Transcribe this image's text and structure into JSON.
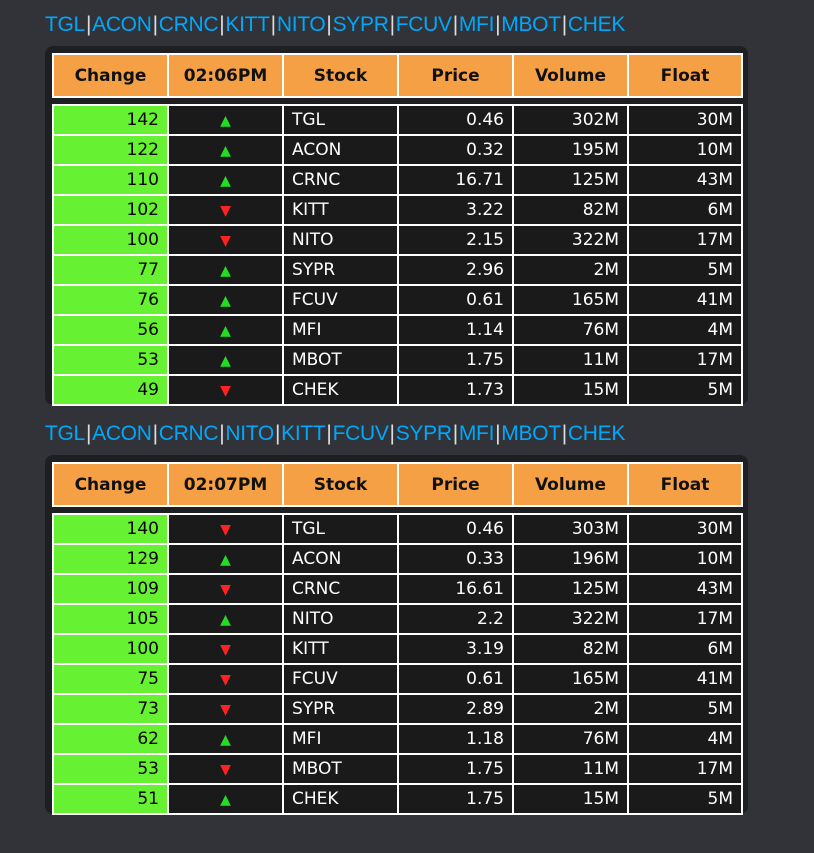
{
  "colors": {
    "header_bg": "#f5a045",
    "change_bg": "#66f233",
    "up": "#22dd22",
    "down": "#ff2222",
    "link": "#00a8fc"
  },
  "snapshots": [
    {
      "tickers": [
        "TGL",
        "ACON",
        "CRNC",
        "KITT",
        "NITO",
        "SYPR",
        "FCUV",
        "MFI",
        "MBOT",
        "CHEK"
      ],
      "headers": {
        "change": "Change",
        "time": "02:06PM",
        "stock": "Stock",
        "price": "Price",
        "volume": "Volume",
        "float": "Float"
      },
      "rows": [
        {
          "change": "142",
          "dir": "up",
          "stock": "TGL",
          "price": "0.46",
          "volume": "302M",
          "float": "30M"
        },
        {
          "change": "122",
          "dir": "up",
          "stock": "ACON",
          "price": "0.32",
          "volume": "195M",
          "float": "10M"
        },
        {
          "change": "110",
          "dir": "up",
          "stock": "CRNC",
          "price": "16.71",
          "volume": "125M",
          "float": "43M"
        },
        {
          "change": "102",
          "dir": "down",
          "stock": "KITT",
          "price": "3.22",
          "volume": "82M",
          "float": "6M"
        },
        {
          "change": "100",
          "dir": "down",
          "stock": "NITO",
          "price": "2.15",
          "volume": "322M",
          "float": "17M"
        },
        {
          "change": "77",
          "dir": "up",
          "stock": "SYPR",
          "price": "2.96",
          "volume": "2M",
          "float": "5M"
        },
        {
          "change": "76",
          "dir": "up",
          "stock": "FCUV",
          "price": "0.61",
          "volume": "165M",
          "float": "41M"
        },
        {
          "change": "56",
          "dir": "up",
          "stock": "MFI",
          "price": "1.14",
          "volume": "76M",
          "float": "4M"
        },
        {
          "change": "53",
          "dir": "up",
          "stock": "MBOT",
          "price": "1.75",
          "volume": "11M",
          "float": "17M"
        },
        {
          "change": "49",
          "dir": "down",
          "stock": "CHEK",
          "price": "1.73",
          "volume": "15M",
          "float": "5M"
        }
      ]
    },
    {
      "tickers": [
        "TGL",
        "ACON",
        "CRNC",
        "NITO",
        "KITT",
        "FCUV",
        "SYPR",
        "MFI",
        "MBOT",
        "CHEK"
      ],
      "headers": {
        "change": "Change",
        "time": "02:07PM",
        "stock": "Stock",
        "price": "Price",
        "volume": "Volume",
        "float": "Float"
      },
      "rows": [
        {
          "change": "140",
          "dir": "down",
          "stock": "TGL",
          "price": "0.46",
          "volume": "303M",
          "float": "30M"
        },
        {
          "change": "129",
          "dir": "up",
          "stock": "ACON",
          "price": "0.33",
          "volume": "196M",
          "float": "10M"
        },
        {
          "change": "109",
          "dir": "down",
          "stock": "CRNC",
          "price": "16.61",
          "volume": "125M",
          "float": "43M"
        },
        {
          "change": "105",
          "dir": "up",
          "stock": "NITO",
          "price": "2.2",
          "volume": "322M",
          "float": "17M"
        },
        {
          "change": "100",
          "dir": "down",
          "stock": "KITT",
          "price": "3.19",
          "volume": "82M",
          "float": "6M"
        },
        {
          "change": "75",
          "dir": "down",
          "stock": "FCUV",
          "price": "0.61",
          "volume": "165M",
          "float": "41M"
        },
        {
          "change": "73",
          "dir": "down",
          "stock": "SYPR",
          "price": "2.89",
          "volume": "2M",
          "float": "5M"
        },
        {
          "change": "62",
          "dir": "up",
          "stock": "MFI",
          "price": "1.18",
          "volume": "76M",
          "float": "4M"
        },
        {
          "change": "53",
          "dir": "down",
          "stock": "MBOT",
          "price": "1.75",
          "volume": "11M",
          "float": "17M"
        },
        {
          "change": "51",
          "dir": "up",
          "stock": "CHEK",
          "price": "1.75",
          "volume": "15M",
          "float": "5M"
        }
      ]
    }
  ]
}
